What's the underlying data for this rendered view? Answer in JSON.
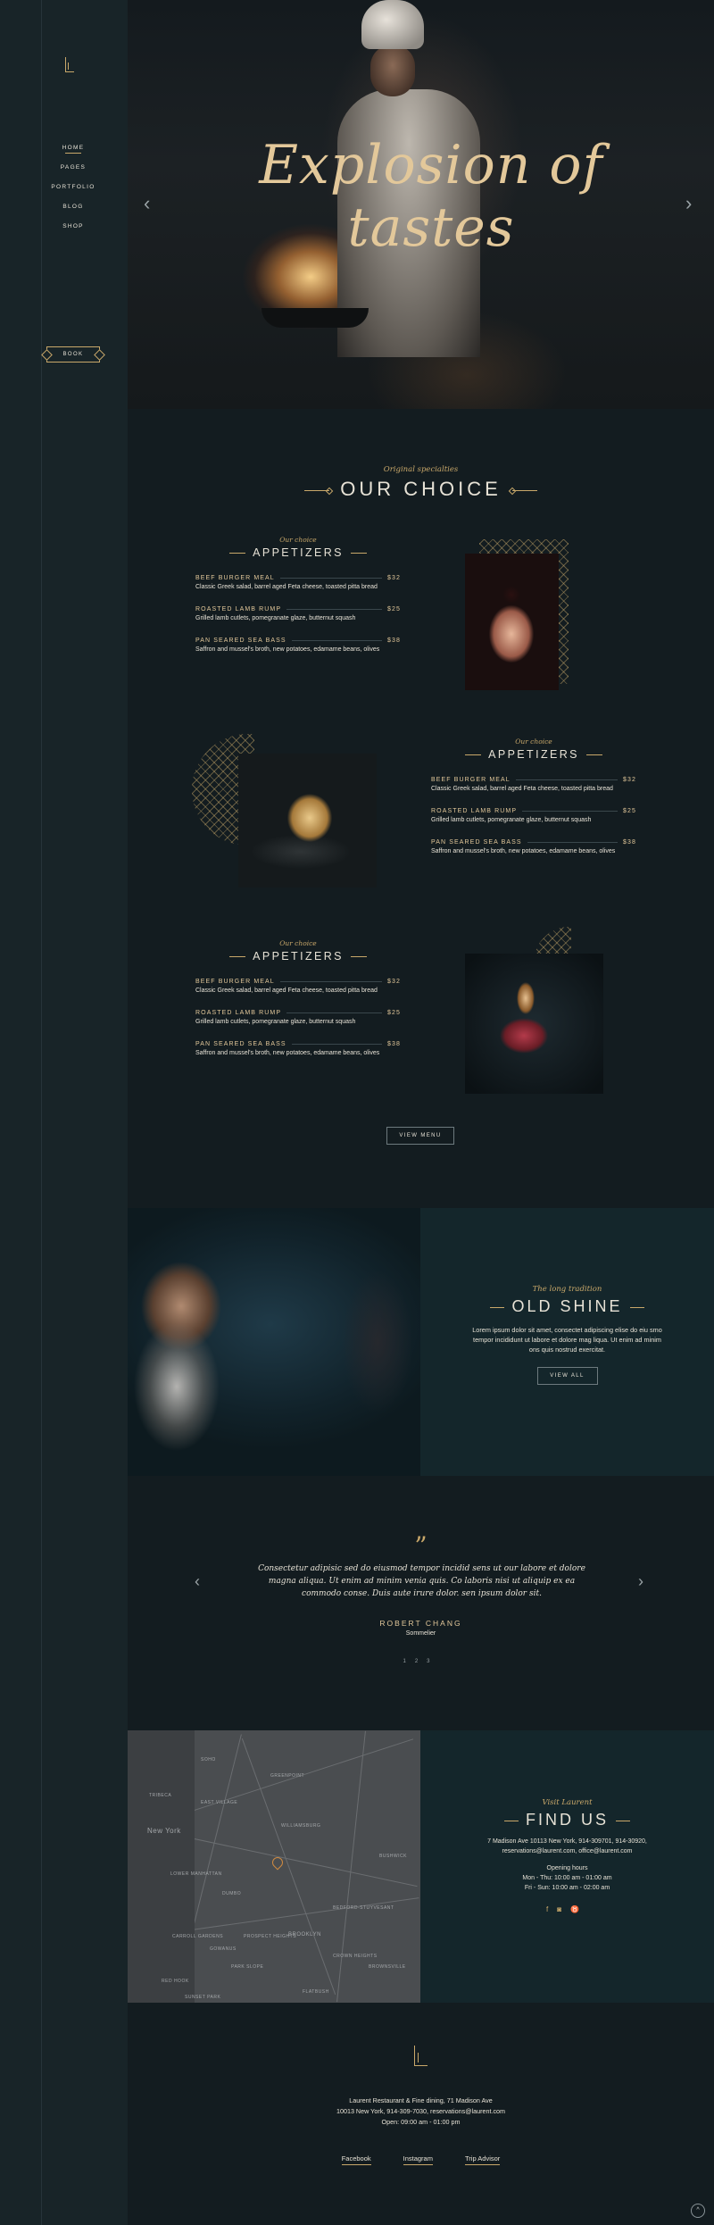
{
  "nav": {
    "items": [
      "HOME",
      "PAGES",
      "PORTFOLIO",
      "BLOG",
      "SHOP"
    ],
    "book": "BOOK"
  },
  "hero": {
    "title": "Explosion of tastes"
  },
  "choice": {
    "kicker": "Original specialties",
    "title": "OUR CHOICE"
  },
  "menus": [
    {
      "kicker": "Our choice",
      "title": "APPETIZERS",
      "items": [
        {
          "name": "BEEF BURGER MEAL",
          "price": "$32",
          "desc": "Classic Greek salad, barrel aged Feta cheese, toasted pitta bread"
        },
        {
          "name": "ROASTED LAMB RUMP",
          "price": "$25",
          "desc": "Grilled lamb cutlets, pomegranate glaze, butternut squash"
        },
        {
          "name": "PAN SEARED SEA BASS",
          "price": "$38",
          "desc": "Saffron and mussel's broth, new potatoes, edamame beans, olives"
        }
      ]
    },
    {
      "kicker": "Our choice",
      "title": "APPETIZERS",
      "items": [
        {
          "name": "BEEF BURGER MEAL",
          "price": "$32",
          "desc": "Classic Greek salad, barrel aged Feta cheese, toasted pitta bread"
        },
        {
          "name": "ROASTED LAMB RUMP",
          "price": "$25",
          "desc": "Grilled lamb cutlets, pomegranate glaze, butternut squash"
        },
        {
          "name": "PAN SEARED SEA BASS",
          "price": "$38",
          "desc": "Saffron and mussel's broth, new potatoes, edamame beans, olives"
        }
      ]
    },
    {
      "kicker": "Our choice",
      "title": "APPETIZERS",
      "items": [
        {
          "name": "BEEF BURGER MEAL",
          "price": "$32",
          "desc": "Classic Greek salad, barrel aged Feta cheese, toasted pitta bread"
        },
        {
          "name": "ROASTED LAMB RUMP",
          "price": "$25",
          "desc": "Grilled lamb cutlets, pomegranate glaze, butternut squash"
        },
        {
          "name": "PAN SEARED SEA BASS",
          "price": "$38",
          "desc": "Saffron and mussel's broth, new potatoes, edamame beans, olives"
        }
      ]
    }
  ],
  "view_menu": "VIEW MENU",
  "shine": {
    "kicker": "The long tradition",
    "title": "OLD SHINE",
    "text": "Lorem ipsum dolor sit amet, consectet adipiscing elise do eiu smo tempor incididunt ut labore et dolore mag liqua. Ut enim ad minim ons quis nostrud exercitat.",
    "button": "VIEW ALL"
  },
  "testimonial": {
    "mark": "”",
    "quote": "Consectetur adipisic sed do eiusmod tempor incidid sens ut our labore et dolore magna aliqua. Ut enim ad minim venia quis. Co laboris nisi ut aliquip ex ea commodo conse. Duis aute irure dolor. sen ipsum dolor sit.",
    "author": "ROBERT CHANG",
    "role": "Sommelier",
    "dots": [
      "1",
      "2",
      "3"
    ]
  },
  "map_labels": [
    "New York",
    "GREENPOINT",
    "EAST VILLAGE",
    "BROOKLYN",
    "LOWER MANHATTAN",
    "WILLIAMSBURG",
    "BUSHWICK",
    "PARK SLOPE",
    "CARROLL GARDENS",
    "PROSPECT HEIGHTS",
    "CROWN HEIGHTS",
    "RED HOOK",
    "GOWANUS",
    "DUMBO",
    "FLATBUSH",
    "SOHO",
    "TRIBECA",
    "BEDFORD-STUYVESANT",
    "SUNSET PARK",
    "BROWNSVILLE"
  ],
  "find": {
    "kicker": "Visit Laurent",
    "title": "FIND US",
    "lines": [
      "7 Madison Ave 10113 New York, 914-309701, 914-30920,",
      "reservations@laurent.com, office@laurent.com"
    ],
    "hours_title": "Opening hours",
    "hours": [
      "Mon - Thu: 10:00 am - 01:00 am",
      "Fri - Sun: 10:00 am - 02:00 am"
    ],
    "social_icons": [
      "facebook-icon",
      "instagram-icon",
      "tripadvisor-icon"
    ]
  },
  "footer": {
    "lines": [
      "Laurent Restaurant & Fine dining, 71 Madison Ave",
      "10013 New York, 914-309-7030, reservations@laurent.com",
      "Open: 09:00 am - 01:00 pm"
    ],
    "links": [
      "Facebook",
      "Instagram",
      "Trip Advisor"
    ]
  },
  "colors": {
    "accent": "#c9a86a",
    "bg": "#131c20",
    "sidebar": "#182428",
    "panel": "#14262b"
  }
}
